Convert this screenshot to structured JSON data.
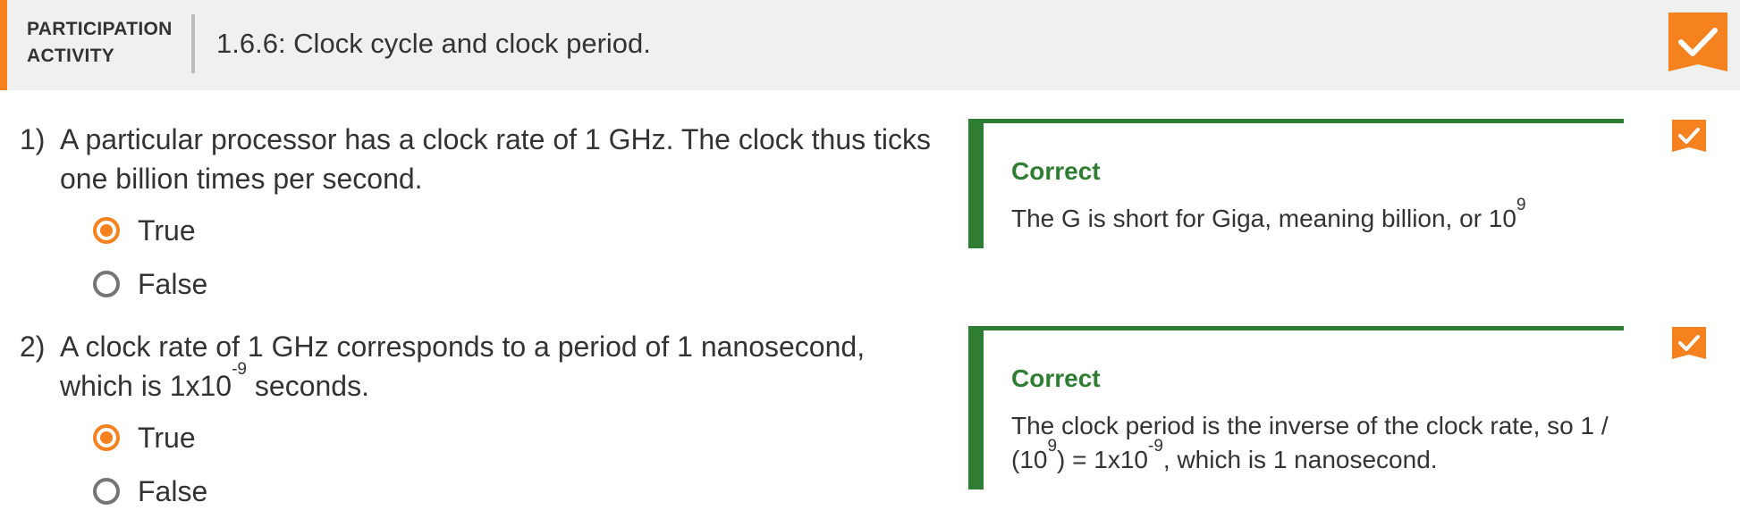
{
  "header": {
    "type_line1": "PARTICIPATION",
    "type_line2": "ACTIVITY",
    "title": "1.6.6: Clock cycle and clock period.",
    "badge_icon": "check-badge-icon",
    "accent": "#f5821f"
  },
  "questions": [
    {
      "number": "1)",
      "text_line1": "A particular processor has a clock rate of 1 GHz. The clock thus ticks",
      "text_line2": "one billion times per second.",
      "options": [
        "True",
        "False"
      ],
      "selected": "True",
      "feedback": {
        "title": "Correct",
        "text_pre": "The G is short for Giga, meaning billion, or 10",
        "text_sup": "9"
      },
      "status_icon": "check-icon"
    },
    {
      "number": "2)",
      "text_line1": "A clock rate of 1 GHz corresponds to a period of 1 nanosecond,",
      "text_line2_pre": "which is 1x10",
      "text_line2_sup": "-9",
      "text_line2_post": " seconds.",
      "options": [
        "True",
        "False"
      ],
      "selected": "True",
      "feedback": {
        "title": "Correct",
        "line1": "The clock period is the inverse of the clock rate, so 1 /",
        "line2_a": "(10",
        "line2_sup1": "9",
        "line2_b": ") = 1x10",
        "line2_sup2": "-9",
        "line2_c": ", which is 1 nanosecond."
      },
      "status_icon": "check-icon"
    }
  ],
  "colors": {
    "correct_green": "#2e7d32",
    "header_bg": "#f0f0f0"
  }
}
